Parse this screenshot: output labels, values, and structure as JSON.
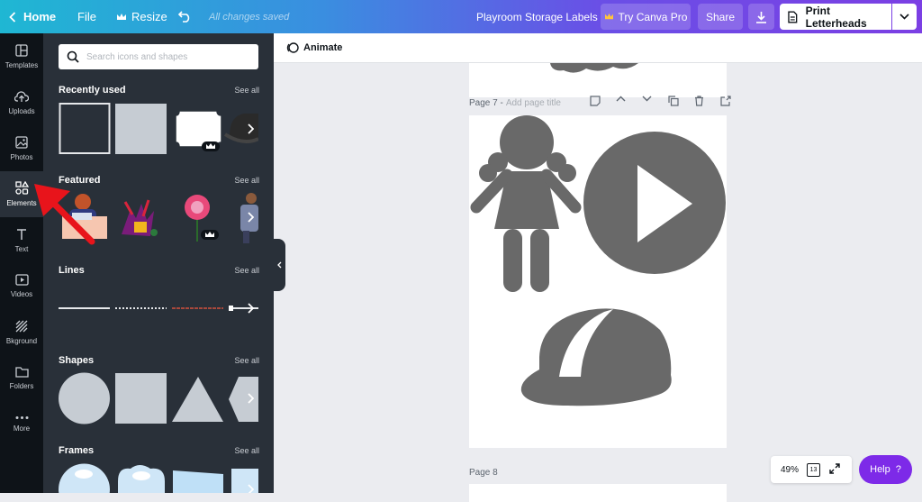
{
  "topbar": {
    "home_label": "Home",
    "file_label": "File",
    "resize_label": "Resize",
    "saved_status": "All changes saved",
    "design_title": "Playroom Storage Labels",
    "try_pro_label": "Try Canva Pro",
    "share_label": "Share",
    "print_label": "Print Letterheads"
  },
  "rail": {
    "items": [
      {
        "label": "Templates",
        "icon": "templates-icon"
      },
      {
        "label": "Uploads",
        "icon": "upload-cloud-icon"
      },
      {
        "label": "Photos",
        "icon": "image-icon"
      },
      {
        "label": "Elements",
        "icon": "shapes-icon",
        "active": true
      },
      {
        "label": "Text",
        "icon": "text-icon"
      },
      {
        "label": "Videos",
        "icon": "video-icon"
      },
      {
        "label": "Bkground",
        "icon": "background-icon"
      },
      {
        "label": "Folders",
        "icon": "folder-icon"
      },
      {
        "label": "More",
        "icon": "more-dots-icon"
      }
    ]
  },
  "panel": {
    "search_placeholder": "Search icons and shapes",
    "see_all": "See all",
    "sections": {
      "recent": "Recently used",
      "featured": "Featured",
      "lines": "Lines",
      "shapes": "Shapes",
      "frames": "Frames"
    }
  },
  "workspace": {
    "animate_label": "Animate",
    "page7_label": "Page 7 -",
    "page7_title_placeholder": "Add page title",
    "page8_label": "Page 8"
  },
  "footer": {
    "zoom": "49%",
    "page_count": "13",
    "help_label": "Help",
    "help_q": "?"
  },
  "colors": {
    "accent": "#7d2ae8",
    "rail_bg": "#0e1318",
    "panel_bg": "#293039",
    "graphic_gray": "#696969",
    "annotation_red": "#e8141b"
  }
}
